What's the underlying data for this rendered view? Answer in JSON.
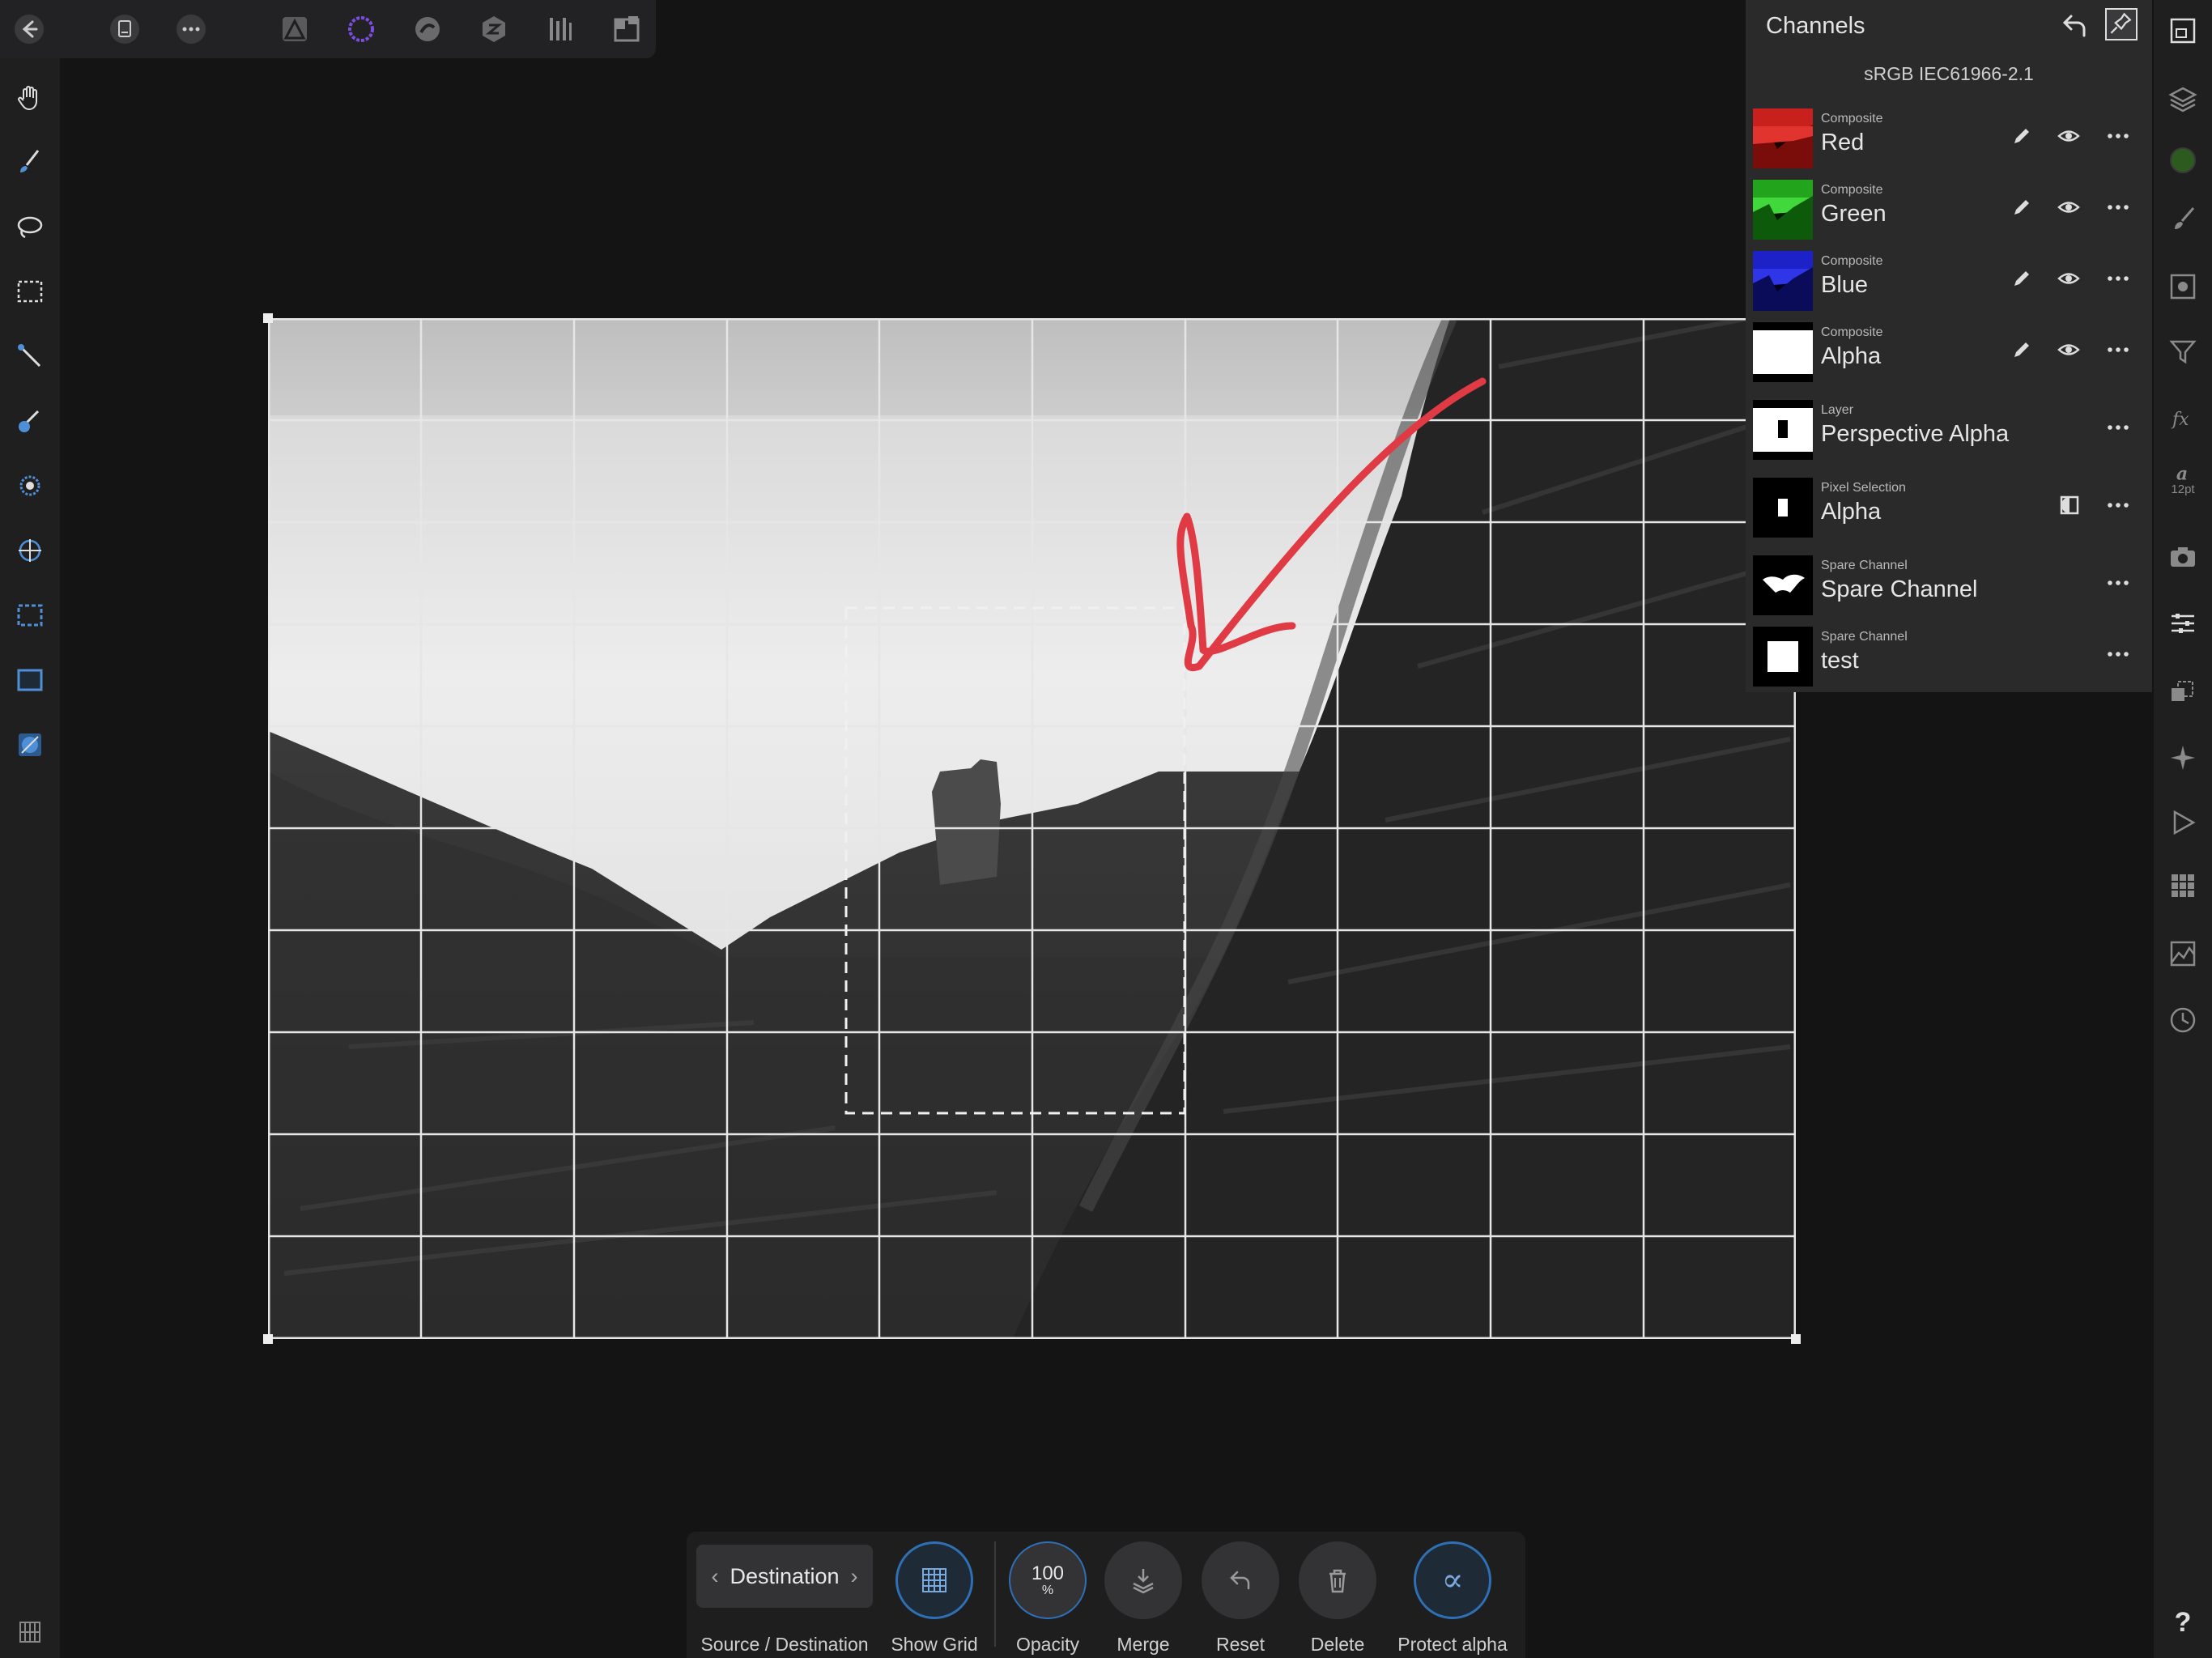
{
  "panel": {
    "title": "Channels",
    "color_profile": "sRGB IEC61966-2.1",
    "rows": [
      {
        "kind": "Composite",
        "name": "Red"
      },
      {
        "kind": "Composite",
        "name": "Green"
      },
      {
        "kind": "Composite",
        "name": "Blue"
      },
      {
        "kind": "Composite",
        "name": "Alpha"
      },
      {
        "kind": "Layer",
        "name": "Perspective Alpha"
      },
      {
        "kind": "Pixel Selection",
        "name": "Alpha"
      },
      {
        "kind": "Spare Channel",
        "name": "Spare Channel"
      },
      {
        "kind": "Spare Channel",
        "name": "test"
      }
    ]
  },
  "context_toolbar": {
    "mode_value": "Destination",
    "mode_label": "Source / Destination",
    "show_grid_label": "Show Grid",
    "opacity_value": "100",
    "opacity_unit": "%",
    "opacity_label": "Opacity",
    "merge_label": "Merge",
    "reset_label": "Reset",
    "delete_label": "Delete",
    "protect_alpha_label": "Protect alpha"
  },
  "right_strip": {
    "text_style_size": "12pt"
  },
  "help_label": "?",
  "colors": {
    "accent_blue": "#2f6fb3",
    "annotation_red": "#e03a45",
    "current_color": "#2d5a1e"
  }
}
